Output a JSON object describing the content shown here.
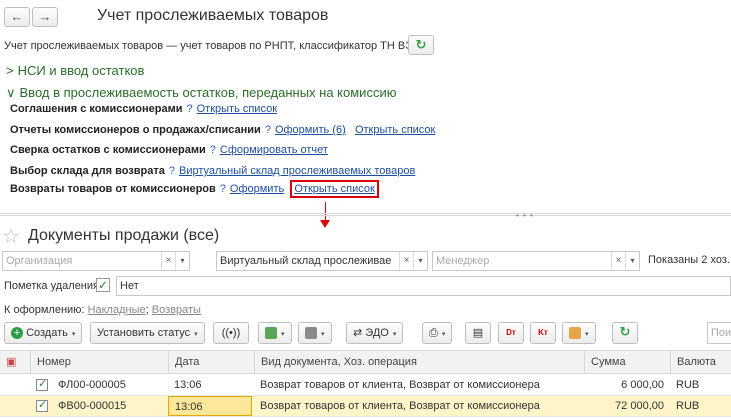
{
  "top": {
    "back_glyph": "←",
    "fwd_glyph": "→",
    "title": "Учет прослеживаемых товаров",
    "description": "Учет прослеживаемых товаров — учет товаров по РНПТ, классификатор ТН ВЭД.",
    "refresh_glyph": "↻"
  },
  "groups": [
    {
      "label": "НСИ и ввод остатков",
      "chevron": ">"
    },
    {
      "label": "Ввод в прослеживаемость остатков, переданных на комиссию",
      "chevron": "∨"
    }
  ],
  "rows": [
    {
      "label": "Соглашения с комиссионерами",
      "q": "?",
      "links": [
        "Открыть список"
      ]
    },
    {
      "label": "Отчеты комиссионеров о продажах/списании",
      "q": "?",
      "links": [
        "Оформить (6)",
        "Открыть список"
      ]
    },
    {
      "label": "Сверка остатков с комиссионерами",
      "q": "?",
      "links": [
        "Сформировать отчет"
      ]
    },
    {
      "label": "Выбор склада для возврата",
      "q": "?",
      "links": [
        "Виртуальный склад прослеживаемых товаров"
      ]
    },
    {
      "label": "Возвраты товаров от комиссионеров",
      "q": "?",
      "links": [
        "Оформить",
        "Открыть список"
      ]
    }
  ],
  "list": {
    "title": "Документы продажи (все)",
    "filters": {
      "org_placeholder": "Организация",
      "warehouse_value": "Виртуальный склад прослеживаемые",
      "manager_placeholder": "Менеджер",
      "shown": "Показаны 2 хоз. о"
    },
    "deletion_mark_label": "Пометка удаления:",
    "deletion_mark_value": "Нет",
    "to_process_label": "К оформлению:",
    "to_process_links": [
      "Накладные",
      "Возвраты"
    ],
    "toolbar": {
      "create": "Создать",
      "set_status": "Установить статус",
      "edo": "ЭДО",
      "search_placeholder": "Пои"
    },
    "columns": [
      "Номер",
      "Дата",
      "Вид документа, Хоз. операция",
      "Сумма",
      "Валюта"
    ],
    "items": [
      {
        "number": "ФЛ00-000005",
        "date": "13:06",
        "type": "Возврат товаров от клиента, Возврат от комиссионера",
        "sum": "6 000,00",
        "currency": "RUB"
      },
      {
        "number": "ФВ00-000015",
        "date": "13:06",
        "type": "Возврат товаров от клиента, Возврат от комиссионера",
        "sum": "72 000,00",
        "currency": "RUB"
      }
    ]
  },
  "colors": {
    "accent_green": "#2b6e2b",
    "link": "#1f4fa0",
    "highlight": "#dd0000",
    "selected_row": "#fff5c9"
  }
}
